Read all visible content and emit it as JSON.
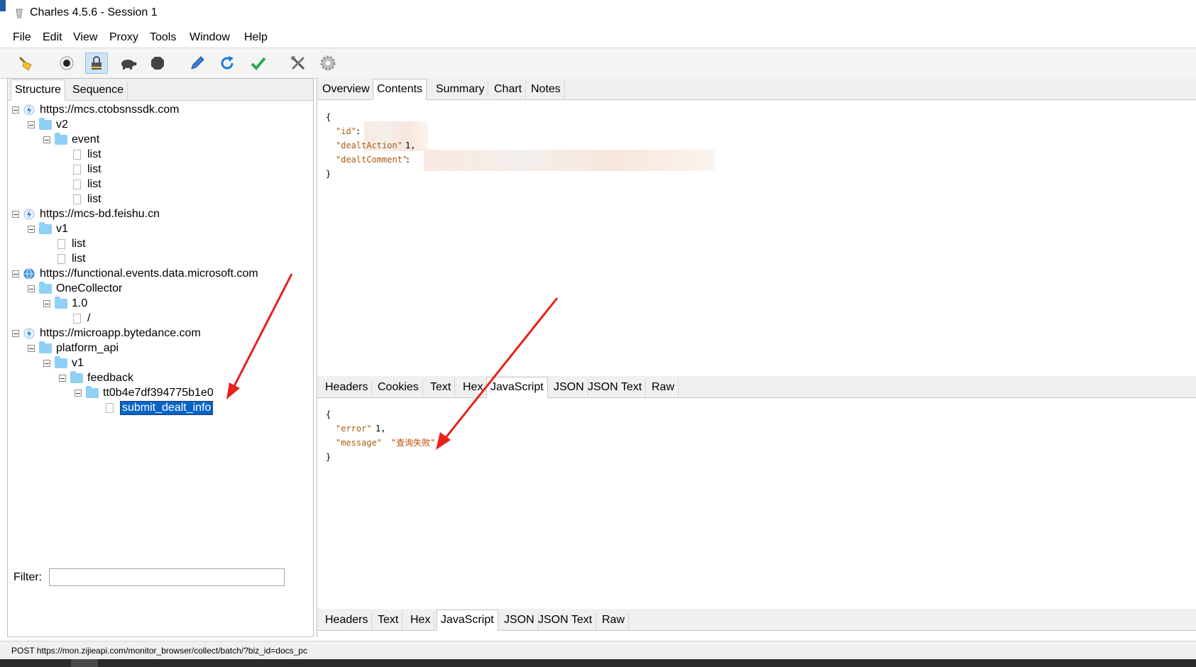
{
  "window": {
    "title": "Charles 4.5.6 - Session 1"
  },
  "menu": [
    "File",
    "Edit",
    "View",
    "Proxy",
    "Tools",
    "Window",
    "Help"
  ],
  "toolbar": {
    "icons": [
      "broom-icon",
      "record-icon",
      "lock-icon",
      "turtle-icon",
      "stop-icon",
      "pen-icon",
      "refresh-icon",
      "check-icon",
      "tools-icon",
      "gear-icon"
    ]
  },
  "left_tabs": [
    "Structure",
    "Sequence"
  ],
  "tree": [
    {
      "label": "https://mcs.ctobsnssdk.com"
    },
    {
      "label": "v2"
    },
    {
      "label": "event"
    },
    {
      "label": "list"
    },
    {
      "label": "list"
    },
    {
      "label": "list"
    },
    {
      "label": "list"
    },
    {
      "label": "https://mcs-bd.feishu.cn"
    },
    {
      "label": "v1"
    },
    {
      "label": "list"
    },
    {
      "label": "list"
    },
    {
      "label": "https://functional.events.data.microsoft.com"
    },
    {
      "label": "OneCollector"
    },
    {
      "label": "1.0"
    },
    {
      "label": "/"
    },
    {
      "label": "https://microapp.bytedance.com"
    },
    {
      "label": "platform_api"
    },
    {
      "label": "v1"
    },
    {
      "label": "feedback"
    },
    {
      "label": "tt0b4e7df394775b1e0"
    },
    {
      "label": "submit_dealt_info"
    }
  ],
  "filter": {
    "label": "Filter:",
    "value": ""
  },
  "right_tabs": [
    "Overview",
    "Contents",
    "Summary",
    "Chart",
    "Notes"
  ],
  "request_tabs": [
    "Headers",
    "Cookies",
    "Text",
    "Hex",
    "JavaScript",
    "JSON",
    "JSON Text",
    "Raw"
  ],
  "response_tabs": [
    "Headers",
    "Text",
    "Hex",
    "JavaScript",
    "JSON",
    "JSON Text",
    "Raw"
  ],
  "request_body": {
    "open": "{",
    "k1": "\"id\"",
    "c1": ":",
    "k2": "\"dealtAction\"",
    "v2": "1,",
    "k3": "\"dealtComment\"",
    "c3": ":",
    "close": "}"
  },
  "response_body": {
    "open": "{",
    "k1": "\"error\"",
    "v1": "1,",
    "k2": "\"message\"",
    "v2": "\"查询失败\"",
    "close": "}"
  },
  "status": {
    "text": "POST https://mon.zijieapi.com/monitor_browser/collect/batch/?biz_id=docs_pc"
  },
  "colors": {
    "selection": "#0a64c8",
    "annotation_arrow": "#e8211b",
    "folder": "#8fd0f5"
  }
}
